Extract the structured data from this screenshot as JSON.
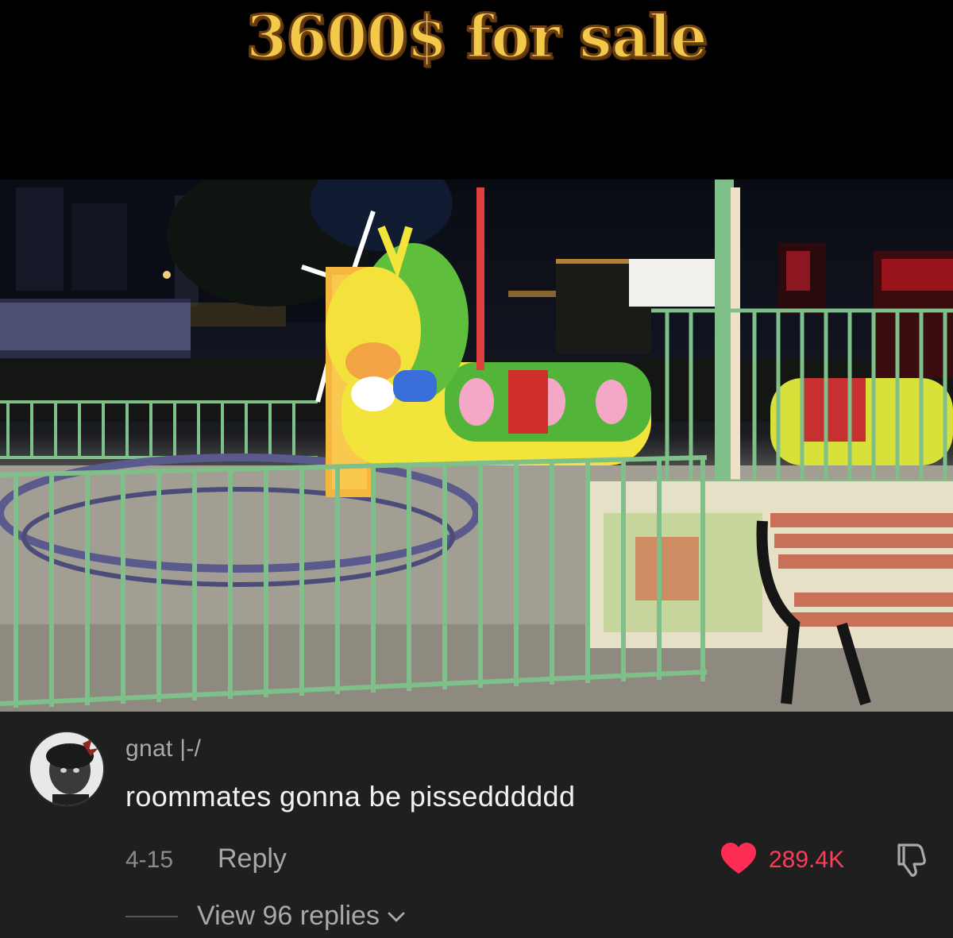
{
  "video": {
    "caption": "3600$ for sale",
    "scene_icon": "caterpillar-ride-photo"
  },
  "comment": {
    "username": "gnat |-/",
    "text": "roommates gonna be pissedddddd",
    "date": "4-15",
    "reply_label": "Reply",
    "like_count": "289.4K",
    "liked": true,
    "view_replies_label": "View 96 replies"
  },
  "colors": {
    "background": "#1f1f1f",
    "like_color": "#ff3b5c",
    "caption_gold": "#f3c94a"
  }
}
